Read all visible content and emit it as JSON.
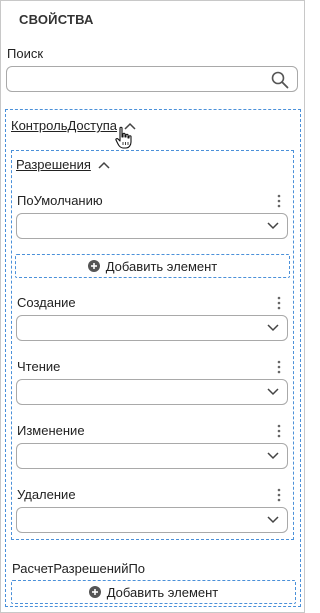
{
  "panel": {
    "title": "СВОЙСТВА"
  },
  "search": {
    "label": "Поиск",
    "value": "",
    "placeholder": ""
  },
  "access_control": {
    "header": "КонтрольДоступа",
    "permissions": {
      "header": "Разрешения",
      "fields": [
        {
          "label": "ПоУмолчанию",
          "value": ""
        },
        {
          "label": "Создание",
          "value": ""
        },
        {
          "label": "Чтение",
          "value": ""
        },
        {
          "label": "Изменение",
          "value": ""
        },
        {
          "label": "Удаление",
          "value": ""
        }
      ],
      "add_button": "Добавить элемент"
    },
    "calc_by": {
      "label": "РасчетРазрешенийПо",
      "add_button": "Добавить элемент"
    }
  },
  "colors": {
    "accent_border": "#4a90d9",
    "input_border": "#a9a9a9"
  },
  "icons": [
    "search-icon",
    "chevron-up-icon",
    "hand-cursor-icon",
    "kebab-icon",
    "chevron-down-icon",
    "plus-circle-icon"
  ]
}
